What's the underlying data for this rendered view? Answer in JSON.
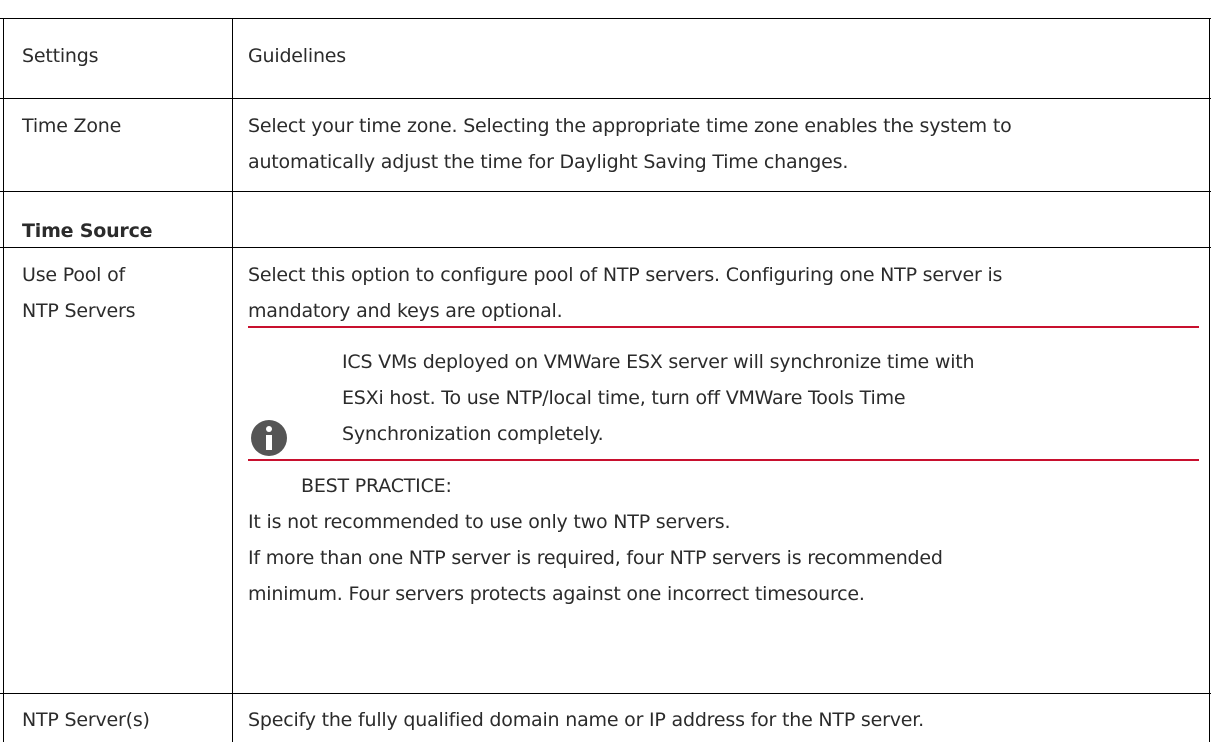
{
  "table": {
    "header": {
      "col1": "Settings",
      "col2": "Guidelines"
    },
    "time_zone": {
      "setting": "Time Zone",
      "line1": "Select your time zone. Selecting the appropriate time zone enables the system to",
      "line2": "automatically adjust the time for Daylight Saving Time changes."
    },
    "time_source": {
      "section_title": "Time Source"
    },
    "pool": {
      "setting_line1": "Use Pool of",
      "setting_line2": "NTP Servers",
      "line1": "Select this option to configure pool of NTP servers. Configuring one NTP server is",
      "line2": "mandatory and keys are optional.",
      "note": {
        "icon": "info-icon",
        "line1": "ICS VMs deployed on VMWare ESX server will synchronize time with",
        "line2": "ESXi host. To use NTP/local time, turn off VMWare Tools Time",
        "line3": "Synchronization completely."
      },
      "best_practice": {
        "title": "BEST PRACTICE:",
        "line1": "It is not recommended to use only two NTP servers.",
        "line2": "If more than one NTP server is required, four NTP servers is recommended",
        "line3": "minimum. Four servers protects against one incorrect timesource."
      }
    },
    "ntp_servers": {
      "setting": "NTP Server(s)",
      "line1": "Specify the fully qualified domain name or IP address for the NTP server."
    }
  },
  "colors": {
    "rule": "#c8102e",
    "text": "#2b2b2b",
    "icon": "#555555"
  }
}
